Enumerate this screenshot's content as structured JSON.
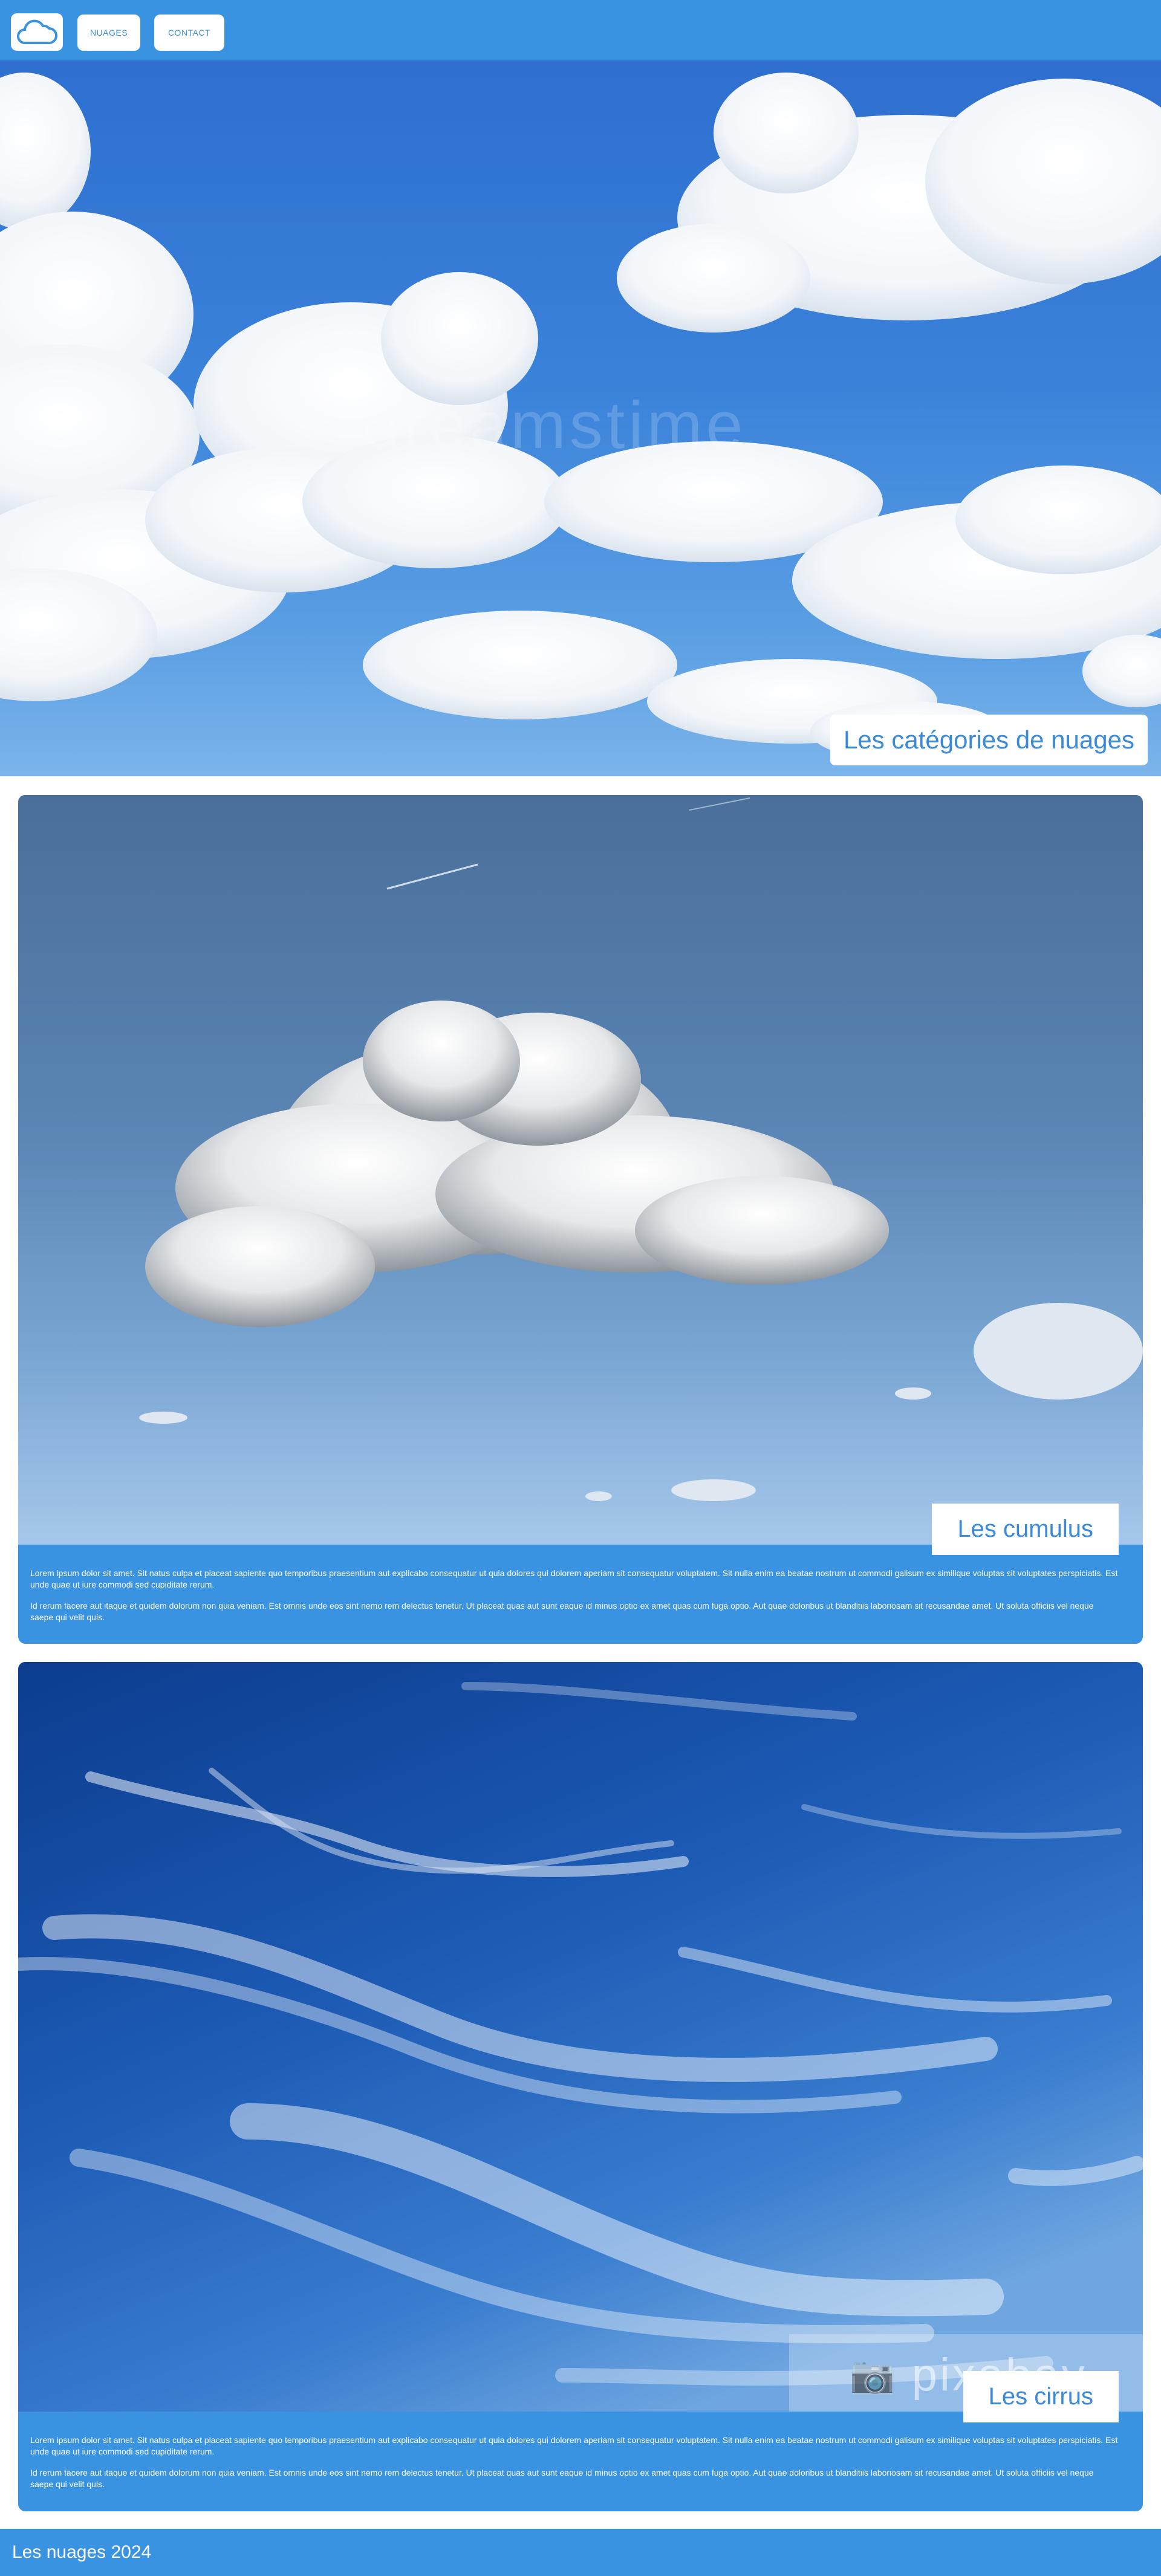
{
  "header": {
    "logo_icon": "cloud-icon",
    "nav": [
      {
        "label": "NUAGES"
      },
      {
        "label": "CONTACT"
      }
    ]
  },
  "hero": {
    "title": "Les catégories de nuages",
    "watermark": "dreamstime"
  },
  "cards": [
    {
      "title": "Les cumulus",
      "paragraphs": [
        "Lorem ipsum dolor sit amet. Sit natus culpa et placeat sapiente quo temporibus praesentium aut explicabo consequatur ut quia dolores qui dolorem aperiam sit consequatur voluptatem. Sit nulla enim ea beatae nostrum ut commodi galisum ex similique voluptas sit voluptates perspiciatis. Est unde quae ut iure commodi sed cupiditate rerum.",
        "Id rerum facere aut itaque et quidem dolorum non quia veniam. Est omnis unde eos sint nemo rem delectus tenetur. Ut placeat quas aut sunt eaque id minus optio ex amet quas cum fuga optio. Aut quae doloribus ut blanditiis laboriosam sit recusandae amet. Ut soluta officiis vel neque saepe qui velit quis."
      ]
    },
    {
      "title": "Les cirrus",
      "watermark": "pixabay",
      "paragraphs": [
        "Lorem ipsum dolor sit amet. Sit natus culpa et placeat sapiente quo temporibus praesentium aut explicabo consequatur ut quia dolores qui dolorem aperiam sit consequatur voluptatem. Sit nulla enim ea beatae nostrum ut commodi galisum ex similique voluptas sit voluptates perspiciatis. Est unde quae ut iure commodi sed cupiditate rerum.",
        "Id rerum facere aut itaque et quidem dolorum non quia veniam. Est omnis unde eos sint nemo rem delectus tenetur. Ut placeat quas aut sunt eaque id minus optio ex amet quas cum fuga optio. Aut quae doloribus ut blanditiis laboriosam sit recusandae amet. Ut soluta officiis vel neque saepe qui velit quis."
      ]
    }
  ],
  "footer": {
    "text": "Les nuages 2024"
  },
  "colors": {
    "accent": "#3a93e0",
    "title_text": "#3a8ad8",
    "background": "#ffffff"
  }
}
